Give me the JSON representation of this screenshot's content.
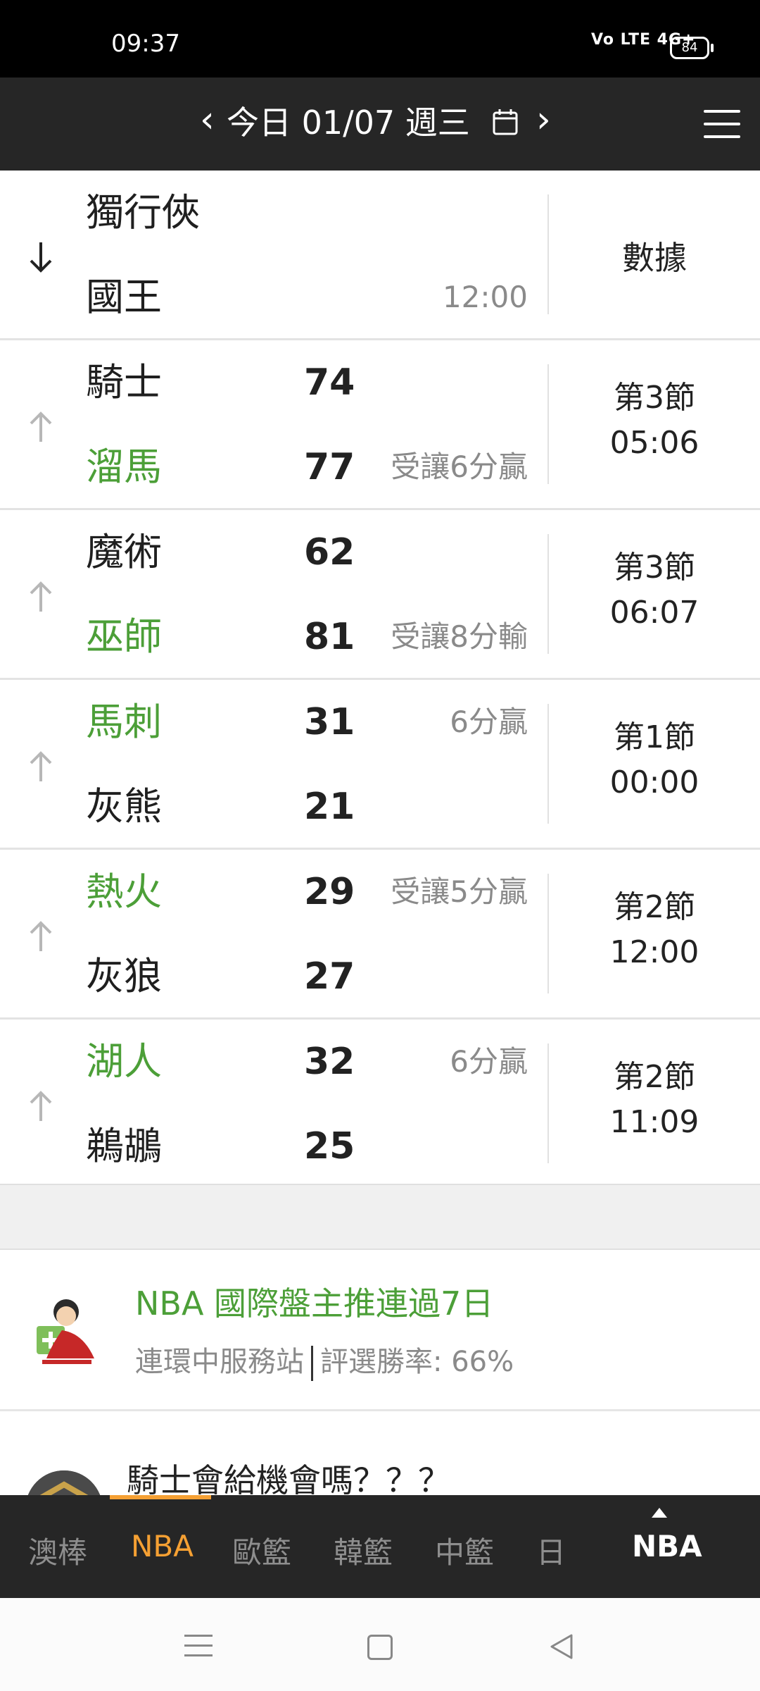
{
  "status_bar": {
    "time": "09:37",
    "network": "Vo LTE 4G+",
    "battery": "84"
  },
  "header": {
    "prev_icon": "chevron-left-icon",
    "date_title": "今日 01/07 週三",
    "calendar_icon": "calendar-icon",
    "next_icon": "chevron-right-icon",
    "menu_icon": "hamburger-menu-icon"
  },
  "games": [
    {
      "arrow": "down",
      "team1": "獨行俠",
      "team1_win": false,
      "score1": "",
      "team2": "國王",
      "team2_win": false,
      "score2": "",
      "handicap1": "",
      "handicap2": "",
      "start_time": "12:00",
      "status_line1": "",
      "status_line2": "",
      "stats_label": "數據"
    },
    {
      "arrow": "up",
      "team1": "騎士",
      "team1_win": false,
      "score1": "74",
      "team2": "溜馬",
      "team2_win": true,
      "score2": "77",
      "handicap1": "",
      "handicap2": "受讓6分贏",
      "start_time": "",
      "status_line1": "第3節",
      "status_line2": "05:06",
      "stats_label": ""
    },
    {
      "arrow": "up",
      "team1": "魔術",
      "team1_win": false,
      "score1": "62",
      "team2": "巫師",
      "team2_win": true,
      "score2": "81",
      "handicap1": "",
      "handicap2": "受讓8分輸",
      "start_time": "",
      "status_line1": "第3節",
      "status_line2": "06:07",
      "stats_label": ""
    },
    {
      "arrow": "up",
      "team1": "馬刺",
      "team1_win": true,
      "score1": "31",
      "team2": "灰熊",
      "team2_win": false,
      "score2": "21",
      "handicap1": "6分贏",
      "handicap2": "",
      "start_time": "",
      "status_line1": "第1節",
      "status_line2": "00:00",
      "stats_label": ""
    },
    {
      "arrow": "up",
      "team1": "熱火",
      "team1_win": true,
      "score1": "29",
      "team2": "灰狼",
      "team2_win": false,
      "score2": "27",
      "handicap1": "受讓5分贏",
      "handicap2": "",
      "start_time": "",
      "status_line1": "第2節",
      "status_line2": "12:00",
      "stats_label": ""
    },
    {
      "arrow": "up",
      "team1": "湖人",
      "team1_win": true,
      "score1": "32",
      "team2": "鵜鶘",
      "team2_win": false,
      "score2": "25",
      "handicap1": "6分贏",
      "handicap2": "",
      "start_time": "",
      "status_line1": "第2節",
      "status_line2": "11:09",
      "stats_label": ""
    }
  ],
  "articles": [
    {
      "title": "NBA 國際盤主推連過7日",
      "author": "連環中服務站",
      "win_rate": "評選勝率: 66%"
    },
    {
      "title": "騎士會給機會嗎？？？"
    }
  ],
  "tabs": [
    "澳棒",
    "NBA",
    "歐籃",
    "韓籃",
    "中籃",
    "日"
  ],
  "active_tab": "NBA",
  "tab_right_label": "NBA",
  "colors": {
    "win_green": "#4c9f38",
    "accent_orange": "#f5a033",
    "header_bg": "#262626"
  }
}
